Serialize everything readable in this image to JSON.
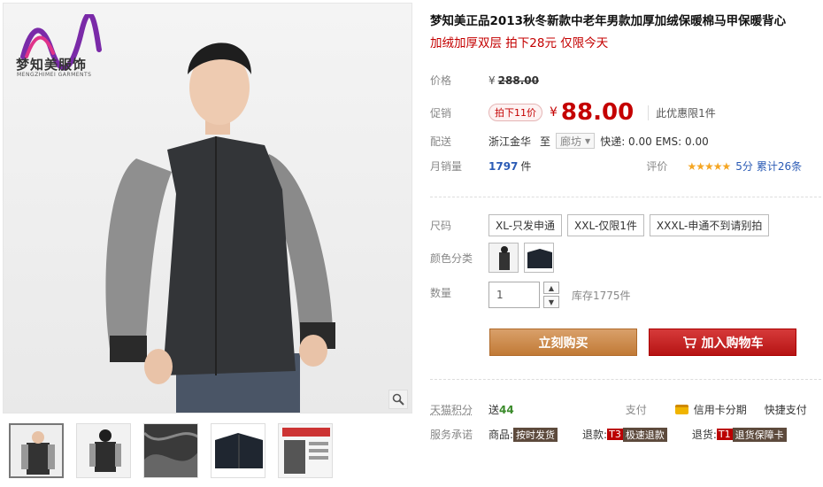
{
  "brand": {
    "name": "梦知美服饰",
    "sub": "MENGZHIMEI GARMENTS"
  },
  "product": {
    "title": "梦知美正品2013秋冬新款中老年男款加厚加绒保暖棉马甲保暖背心",
    "subtitle": "加绒加厚双层 拍下28元 仅限今天"
  },
  "price": {
    "label": "价格",
    "yen": "¥",
    "original": "288.00",
    "promo_label": "促销",
    "promo_tag": "拍下11价",
    "current": "88.00",
    "limit": "此优惠限1件"
  },
  "shipping": {
    "label": "配送",
    "from": "浙江金华",
    "to_word": "至",
    "dest": "廊坊",
    "fees": "快递: 0.00 EMS: 0.00"
  },
  "sales": {
    "label": "月销量",
    "count": "1797",
    "unit": "件",
    "rating_label": "评价",
    "stars": "★★★★★",
    "score": "5分",
    "reviews": "累计26条"
  },
  "size": {
    "label": "尺码",
    "options": [
      "XL-只发申通",
      "XXL-仅限1件",
      "XXXL-申通不到请别拍"
    ]
  },
  "color": {
    "label": "颜色分类"
  },
  "quantity": {
    "label": "数量",
    "value": "1",
    "up": "▲",
    "down": "▼",
    "stock": "库存1775件"
  },
  "actions": {
    "buy": "立刻购买",
    "cart": "加入购物车"
  },
  "points": {
    "label": "天猫积分",
    "prefix": "送",
    "value": "44",
    "pay_label": "支付",
    "installment": "信用卡分期",
    "quick_pay": "快捷支付"
  },
  "service": {
    "label": "服务承诺",
    "goods_label": "商品:",
    "goods_tag": "按时发货",
    "return_label": "退款:",
    "return_code": "T3",
    "return_tag": "极速退款",
    "exchange_label": "退货:",
    "exchange_code": "T1",
    "exchange_tag": "退货保障卡"
  },
  "colors": {
    "accent": "#c40000",
    "buy": "#c17a36",
    "cart": "#b61414"
  }
}
